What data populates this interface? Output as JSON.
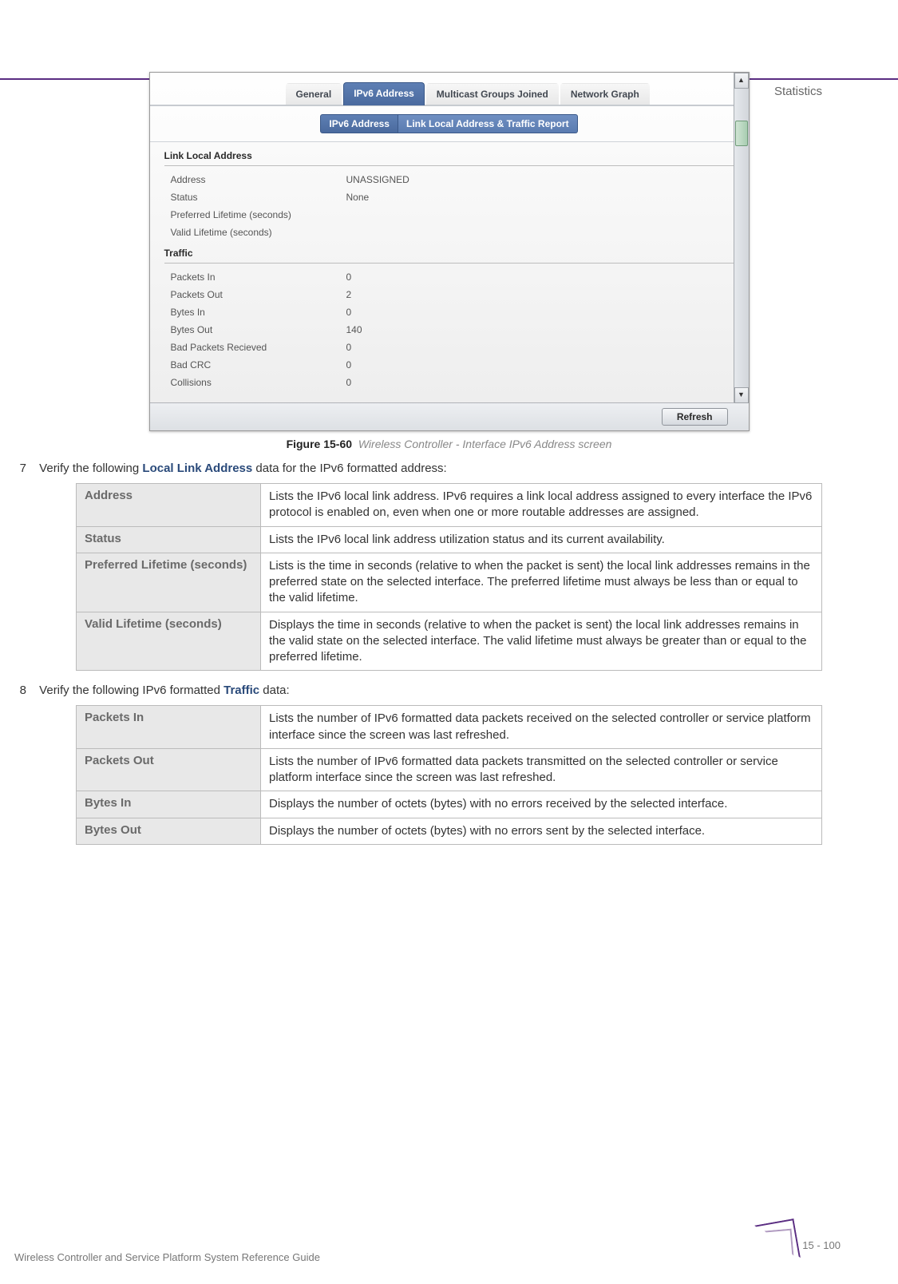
{
  "header": {
    "section": "Statistics"
  },
  "screenshot": {
    "main_tabs": [
      "General",
      "IPv6 Address",
      "Multicast Groups Joined",
      "Network Graph"
    ],
    "main_active_index": 1,
    "sub_tabs": [
      "IPv6 Address",
      "Link Local Address & Traffic Report"
    ],
    "sub_active_index": 1,
    "fieldset1_title": "Link Local Address",
    "link_local": {
      "rows": [
        {
          "label": "Address",
          "value": "UNASSIGNED"
        },
        {
          "label": "Status",
          "value": "None"
        },
        {
          "label": "Preferred Lifetime (seconds)",
          "value": ""
        },
        {
          "label": "Valid Lifetime (seconds)",
          "value": ""
        }
      ]
    },
    "fieldset2_title": "Traffic",
    "traffic": {
      "rows": [
        {
          "label": "Packets In",
          "value": "0"
        },
        {
          "label": "Packets Out",
          "value": "2"
        },
        {
          "label": "Bytes In",
          "value": "0"
        },
        {
          "label": "Bytes Out",
          "value": "140"
        },
        {
          "label": "Bad Packets Recieved",
          "value": "0"
        },
        {
          "label": "Bad CRC",
          "value": "0"
        },
        {
          "label": "Collisions",
          "value": "0"
        }
      ]
    },
    "refresh_label": "Refresh"
  },
  "figure": {
    "num": "Figure 15-60",
    "caption": "Wireless Controller - Interface IPv6 Address screen"
  },
  "step7": {
    "num": "7",
    "text_before": "Verify the following ",
    "bold": "Local Link Address",
    "text_after": " data for the IPv6 formatted address:"
  },
  "table1": [
    {
      "term": "Address",
      "desc": "Lists the IPv6 local link address. IPv6 requires a link local address assigned to every interface the IPv6 protocol is enabled on, even when one or more routable addresses are assigned."
    },
    {
      "term": "Status",
      "desc": "Lists the IPv6 local link address utilization status and its current availability."
    },
    {
      "term": "Preferred Lifetime (seconds)",
      "desc": "Lists is the time in seconds (relative to when the packet is sent) the local link addresses remains in the preferred state on the selected interface. The preferred lifetime must always be less than or equal to the valid lifetime."
    },
    {
      "term": "Valid Lifetime (seconds)",
      "desc": "Displays the time in seconds (relative to when the packet is sent) the local link addresses remains in the valid state on the selected interface. The valid lifetime must always be greater than or equal to the preferred lifetime."
    }
  ],
  "step8": {
    "num": "8",
    "text_before": "Verify the following IPv6 formatted ",
    "bold": "Traffic",
    "text_after": " data:"
  },
  "table2": [
    {
      "term": "Packets In",
      "desc": "Lists the number of IPv6 formatted data packets received on the selected controller or service platform interface since the screen was last refreshed."
    },
    {
      "term": "Packets Out",
      "desc": "Lists the number of IPv6 formatted data packets transmitted on the selected controller or service platform interface since the screen was last refreshed."
    },
    {
      "term": "Bytes In",
      "desc": "Displays the number of octets (bytes) with no errors received by the selected interface."
    },
    {
      "term": "Bytes Out",
      "desc": "Displays the number of octets (bytes) with no errors sent by the selected interface."
    }
  ],
  "footer": {
    "guide": "Wireless Controller and Service Platform System Reference Guide",
    "page": "15 - 100"
  }
}
